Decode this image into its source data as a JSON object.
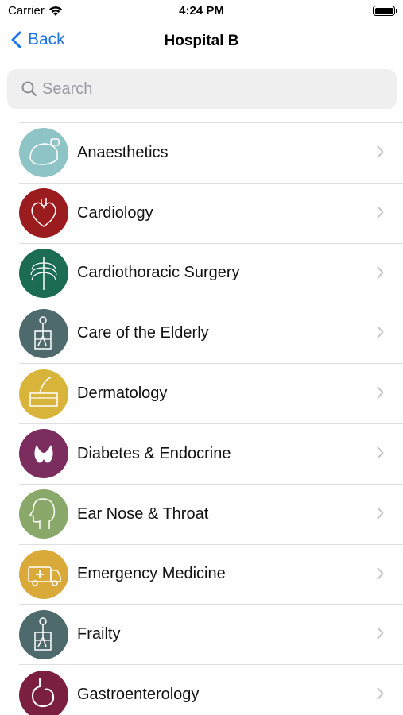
{
  "status_bar": {
    "carrier": "Carrier",
    "time": "4:24 PM"
  },
  "nav": {
    "back_label": "Back",
    "title": "Hospital B"
  },
  "search": {
    "placeholder": "Search"
  },
  "specialties": [
    {
      "label": "Anaesthetics",
      "color": "#8fc4c6",
      "icon": "anaesthetic-mask-icon"
    },
    {
      "label": "Cardiology",
      "color": "#9b1c1f",
      "icon": "heart-icon"
    },
    {
      "label": "Cardiothoracic Surgery",
      "color": "#1b6b55",
      "icon": "ribcage-icon"
    },
    {
      "label": "Care of the Elderly",
      "color": "#4f6a6d",
      "icon": "walking-frame-icon"
    },
    {
      "label": "Dermatology",
      "color": "#d8b53a",
      "icon": "skin-layers-icon"
    },
    {
      "label": "Diabetes & Endocrine",
      "color": "#7a2d5e",
      "icon": "thyroid-icon"
    },
    {
      "label": "Ear Nose & Throat",
      "color": "#8aa86a",
      "icon": "head-profile-icon"
    },
    {
      "label": "Emergency Medicine",
      "color": "#d9a93a",
      "icon": "ambulance-icon"
    },
    {
      "label": "Frailty",
      "color": "#4f6a6d",
      "icon": "walking-frame-icon"
    },
    {
      "label": "Gastroenterology",
      "color": "#7a1f3f",
      "icon": "stomach-icon"
    }
  ]
}
